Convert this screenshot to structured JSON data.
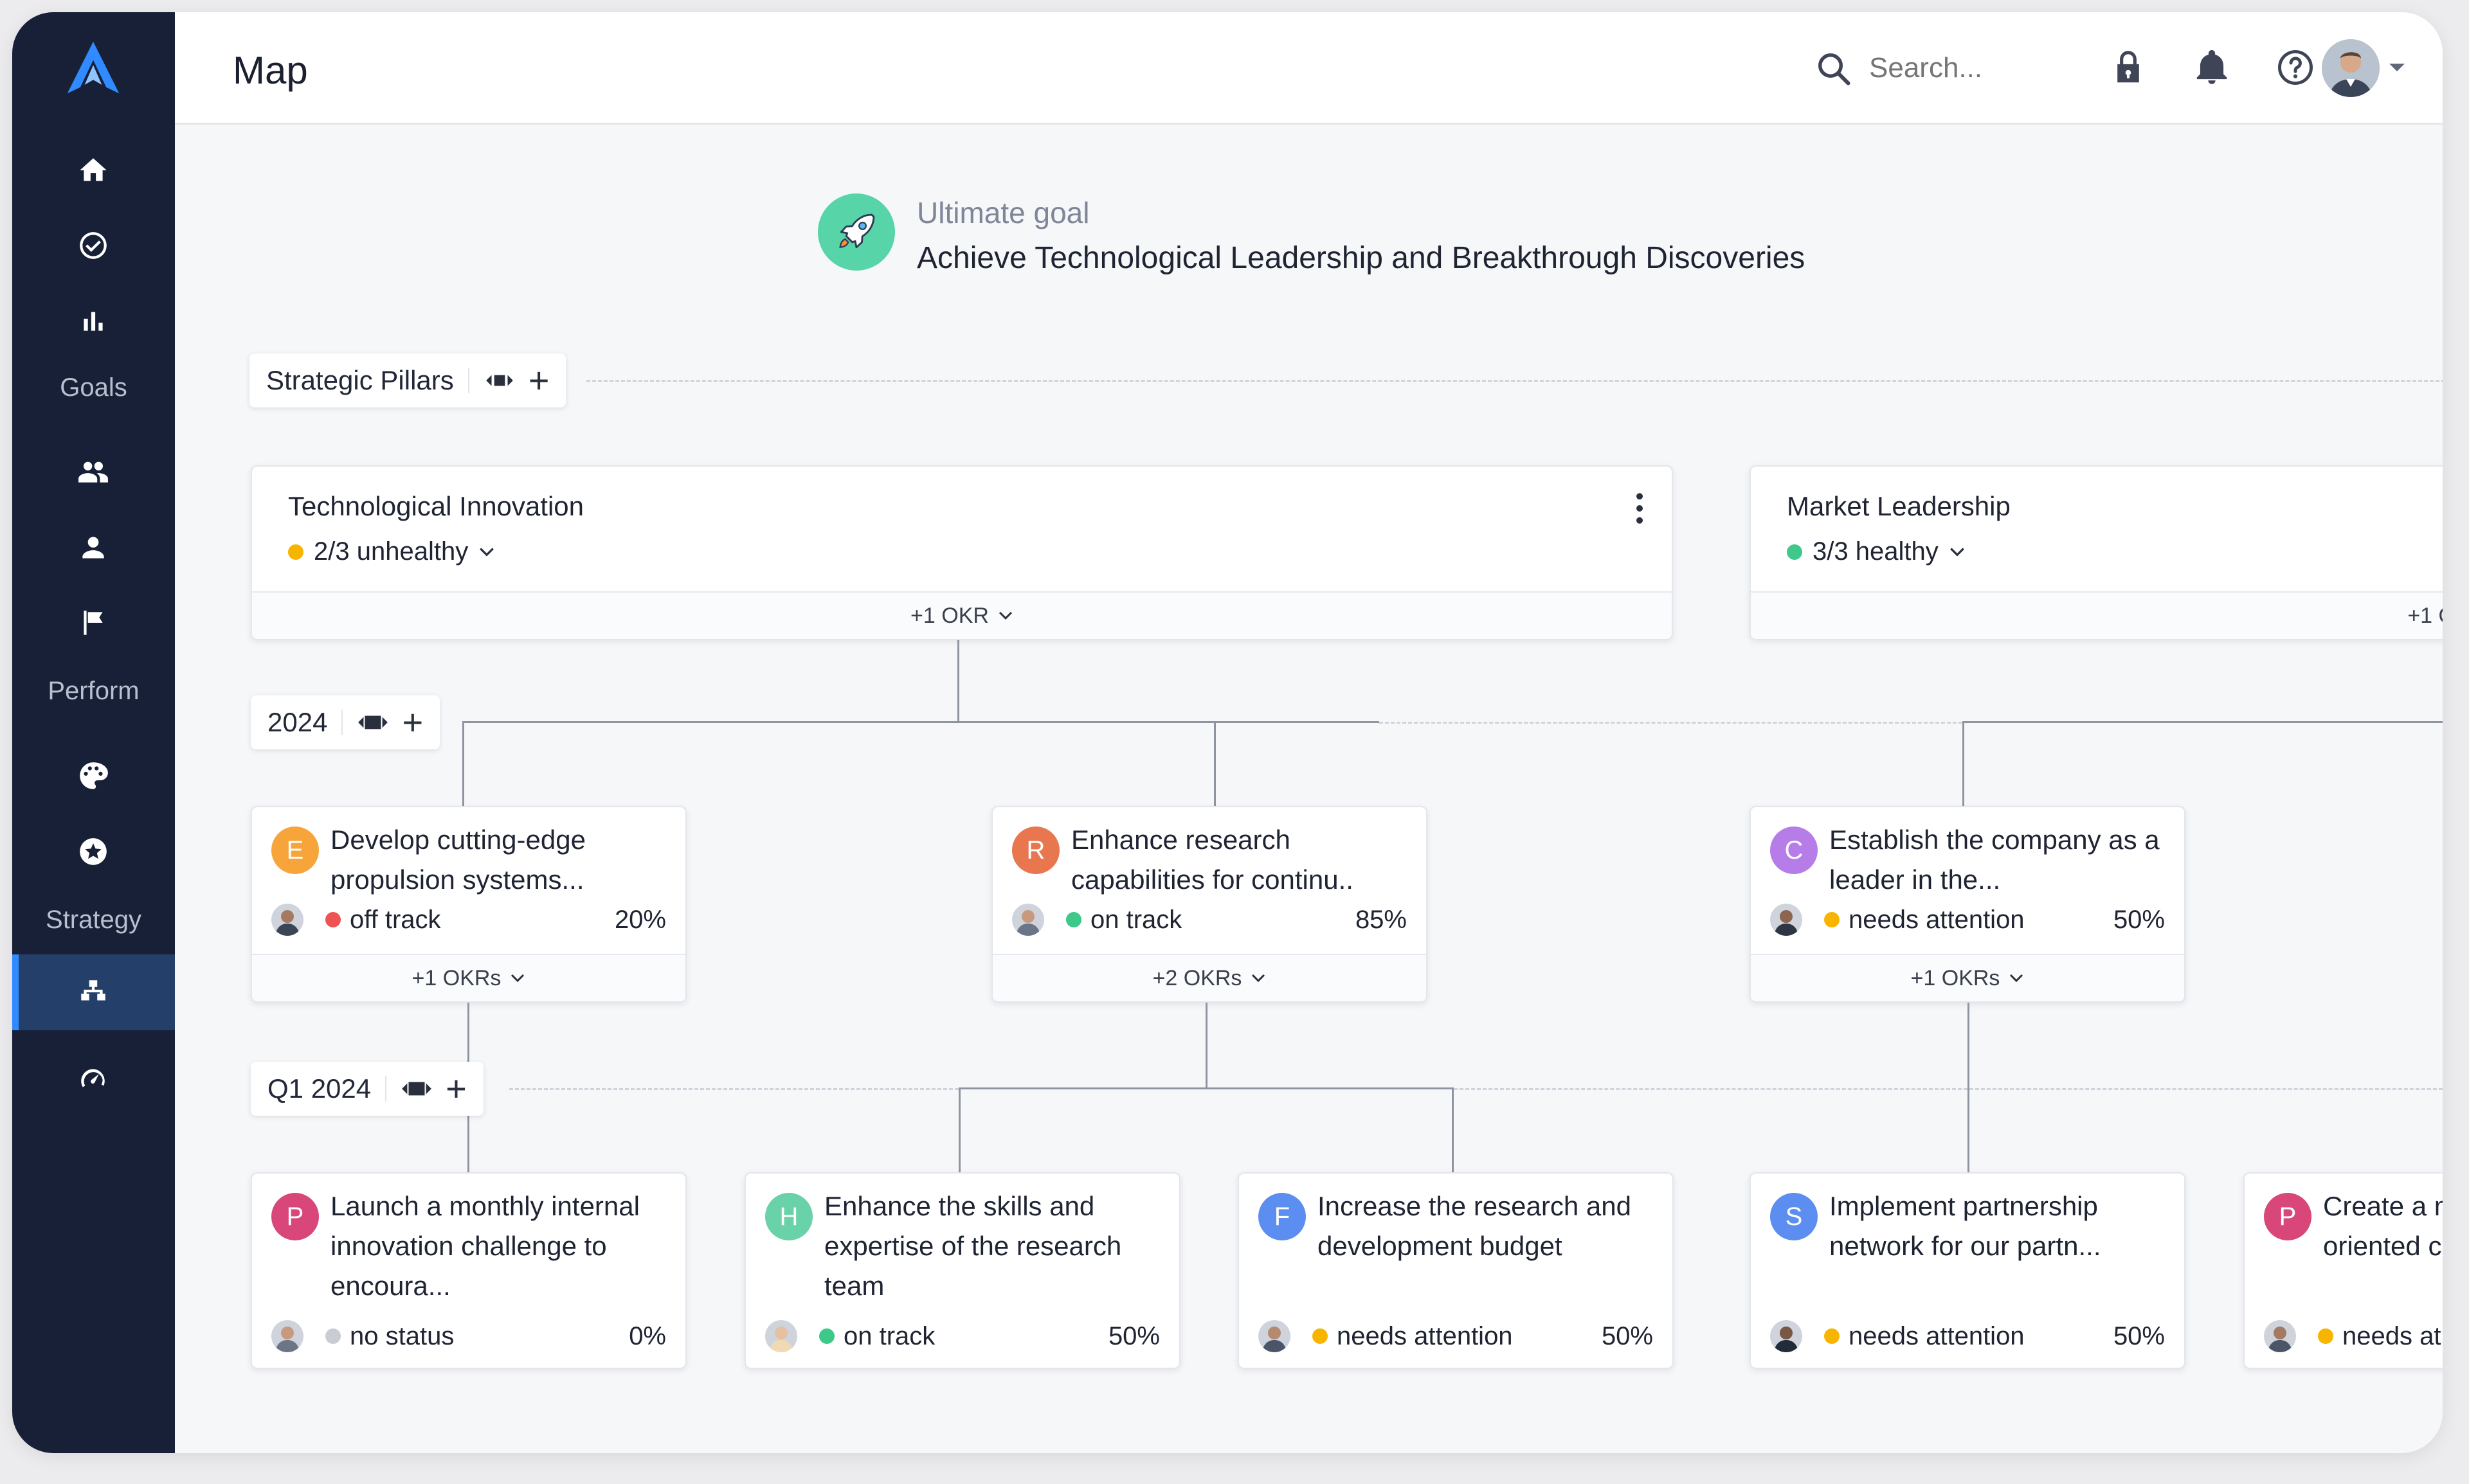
{
  "sidebar": {
    "labels": {
      "goals": "Goals",
      "perform": "Perform",
      "strategy": "Strategy"
    },
    "icons": [
      "logo-icon",
      "home-icon",
      "check-circle-icon",
      "bar-chart-icon",
      "group-icon",
      "person-icon",
      "flag-icon",
      "palette-icon",
      "star-icon",
      "org-chart-icon",
      "gauge-icon"
    ],
    "active": "org-chart-icon"
  },
  "header": {
    "title": "Map",
    "search_placeholder": "Search...",
    "icons": [
      "search-icon",
      "lock-icon",
      "bell-icon",
      "help-icon",
      "avatar",
      "chevron-down-icon"
    ]
  },
  "goal": {
    "label": "Ultimate goal",
    "title": "Achieve Technological Leadership and Breakthrough Discoveries",
    "icon": "rocket-icon"
  },
  "levels": {
    "pillars": "Strategic Pillars",
    "year": "2024",
    "quarter": "Q1 2024"
  },
  "colors": {
    "off_track": "#ee5253",
    "on_track": "#3ec98a",
    "needs_attention": "#f7b500",
    "no_status": "#c9ccd3",
    "unhealthy": "#f7b500",
    "healthy": "#3ec98a",
    "accent": "#2f8bff"
  },
  "pillars": [
    {
      "name": "Technological Innovation",
      "health": "2/3 unhealthy",
      "status": "unhealthy",
      "footer": "+1 OKR"
    },
    {
      "name": "Market Leadership",
      "health": "3/3 healthy",
      "status": "healthy",
      "footer": "+1 O"
    }
  ],
  "year_okrs": [
    {
      "badge": "E",
      "badge_color": "#f7a53b",
      "title": "Develop cutting-edge propulsion systems...",
      "status": "off track",
      "status_key": "off_track",
      "percent": "20%",
      "footer": "+1 OKRs"
    },
    {
      "badge": "R",
      "badge_color": "#e8764f",
      "title": "Enhance research capabilities for continu..",
      "status": "on track",
      "status_key": "on_track",
      "percent": "85%",
      "footer": "+2 OKRs"
    },
    {
      "badge": "C",
      "badge_color": "#b67ce8",
      "title": "Establish the company as a leader in the...",
      "status": "needs attention",
      "status_key": "needs_attention",
      "percent": "50%",
      "footer": "+1 OKRs"
    }
  ],
  "quarter_okrs": [
    {
      "badge": "P",
      "badge_color": "#d9477a",
      "title": "Launch a monthly internal innovation challenge to encoura...",
      "status": "no status",
      "status_key": "no_status",
      "percent": "0%"
    },
    {
      "badge": "H",
      "badge_color": "#69d2a8",
      "title": "Enhance the skills and expertise of the research team",
      "status": "on track",
      "status_key": "on_track",
      "percent": "50%"
    },
    {
      "badge": "F",
      "badge_color": "#5b8ef0",
      "title": "Increase the research and development budget",
      "status": "needs attention",
      "status_key": "needs_attention",
      "percent": "50%"
    },
    {
      "badge": "S",
      "badge_color": "#5b8ef0",
      "title": "Implement partnership network for our partn...",
      "status": "needs attention",
      "status_key": "needs_attention",
      "percent": "50%"
    },
    {
      "badge": "P",
      "badge_color": "#d9477a",
      "title": "Create a m oriented cu",
      "status": "needs at",
      "status_key": "needs_attention",
      "percent": ""
    }
  ]
}
